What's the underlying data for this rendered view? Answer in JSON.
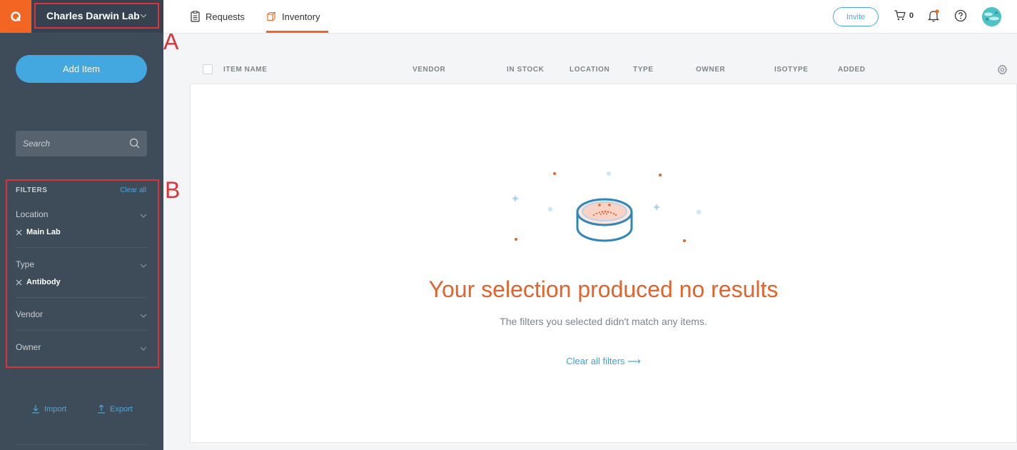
{
  "sidebar": {
    "lab_name": "Charles Darwin Lab",
    "add_item_label": "Add Item",
    "search_placeholder": "Search",
    "filters": {
      "heading": "FILTERS",
      "clear_all": "Clear all",
      "groups": [
        {
          "title": "Location",
          "chip": "Main Lab"
        },
        {
          "title": "Type",
          "chip": "Antibody"
        },
        {
          "title": "Vendor"
        },
        {
          "title": "Owner"
        }
      ]
    },
    "import_label": "Import",
    "export_label": "Export"
  },
  "topbar": {
    "tabs": [
      {
        "label": "Requests"
      },
      {
        "label": "Inventory",
        "active": true
      }
    ],
    "invite_label": "Invite",
    "cart_count": "0"
  },
  "annotations": {
    "a": "A",
    "b": "B"
  },
  "table": {
    "columns": [
      "ITEM NAME",
      "VENDOR",
      "IN STOCK",
      "LOCATION",
      "TYPE",
      "OWNER",
      "ISOTYPE",
      "ADDED"
    ]
  },
  "empty_state": {
    "title": "Your selection produced no results",
    "subtitle": "The filters you selected didn't match any items.",
    "clear_link": "Clear all filters ⟶"
  },
  "colors": {
    "sidebar": "#3e4b58",
    "brand_orange": "#f26522",
    "accent_blue": "#43a7e0",
    "annotation_red": "#d9343a"
  }
}
